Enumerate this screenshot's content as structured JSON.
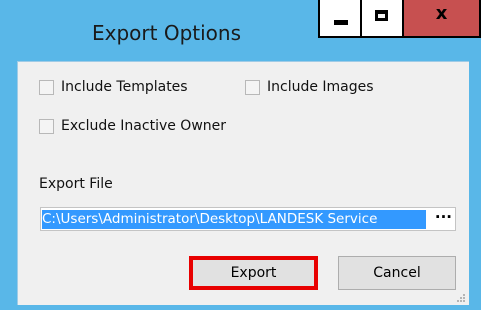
{
  "window": {
    "title": "Export Options",
    "controls": {
      "minimize": "",
      "maximize": "",
      "close": "x"
    }
  },
  "options": {
    "include_templates": {
      "label": "Include Templates",
      "checked": false
    },
    "include_images": {
      "label": "Include Images",
      "checked": false
    },
    "exclude_inactive_owner": {
      "label": "Exclude Inactive Owner",
      "checked": false
    }
  },
  "export_file": {
    "label": "Export File",
    "value": "C:\\Users\\Administrator\\Desktop\\LANDESK Service",
    "browse_label": "···"
  },
  "buttons": {
    "export": "Export",
    "cancel": "Cancel"
  },
  "colors": {
    "accent": "#59b7e8",
    "close": "#c75050",
    "highlight": "#e80000",
    "selection": "#3399ff"
  }
}
